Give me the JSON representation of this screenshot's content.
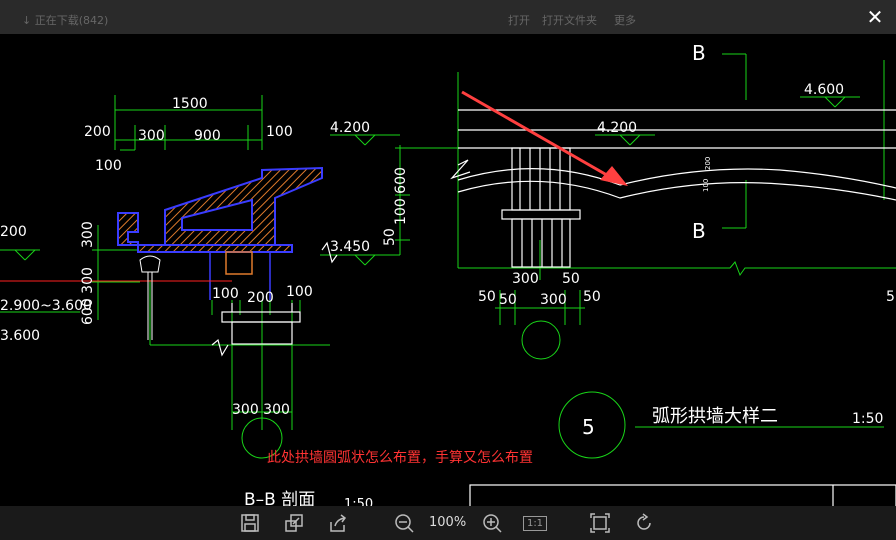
{
  "topbar": {
    "download_label": "正在下载(842)",
    "ghost_open": "打开",
    "ghost_open_folder": "打开文件夹",
    "ghost_more": "更多"
  },
  "drawing": {
    "left_section": {
      "title": "B–B 剖面",
      "scale": "1:50",
      "dim_top": "1500",
      "dim_200": "200",
      "dim_300": "300",
      "dim_900": "900",
      "dim_100_right": "100",
      "dim_100_left": "100",
      "elev_4200": "4.200",
      "elev_3450": "3.450",
      "dim_100_600": "100 600",
      "dim_50": "50",
      "dim_300_vert": "300",
      "dim_600_300": "600 300",
      "elev_200_left": "200",
      "elev_range": "2.900~3.600",
      "elev_3600": "3.600",
      "bottom_100a": "100",
      "bottom_200": "200",
      "bottom_100b": "100",
      "base_300_300": "300 300"
    },
    "right_section": {
      "label_b_top": "B",
      "label_b_bottom": "B",
      "elev_4600": "4.600",
      "elev_4200": "4.200",
      "small_200": "200",
      "small_100": "100",
      "dim_300": "300",
      "dim_50": "50",
      "dim_50_left": "50",
      "dim_50_a": "50",
      "dim_300_b": "300",
      "dim_50_b": "50",
      "dim_5_right": "5",
      "detail_number": "5",
      "detail_title": "弧形拱墙大样二",
      "detail_scale": "1:50"
    },
    "annotation": "此处拱墙圆弧状怎么布置，手算又怎么布置",
    "colors": {
      "green": "#19d419",
      "white": "#ffffff",
      "blue": "#3a3cff",
      "red_arrow": "#ff4040",
      "annotation_red": "#ff3333",
      "orange": "#e07b2c"
    }
  },
  "toolbar": {
    "save_icon": "save-icon",
    "zoom_level": "100%",
    "actual_size_label": "1:1"
  }
}
